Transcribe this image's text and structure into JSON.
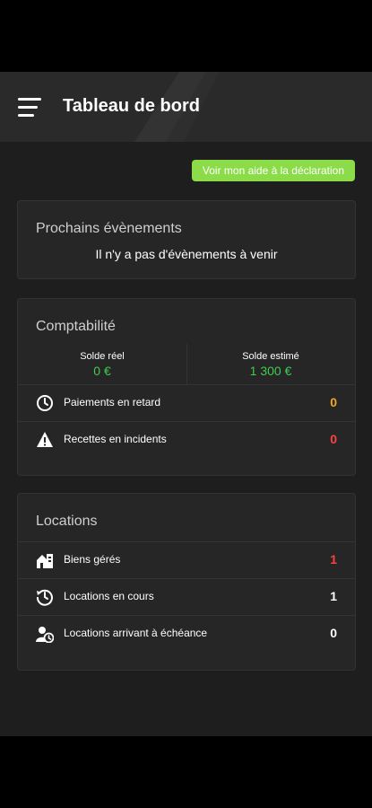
{
  "header": {
    "title": "Tableau de bord",
    "menu_icon": "hamburger-menu-icon"
  },
  "aid_button": {
    "label": "Voir mon aide à la déclaration",
    "color": "#8cdc4a"
  },
  "events": {
    "title": "Prochains évènements",
    "empty_text": "Il n'y a pas d'évènements à venir"
  },
  "compta": {
    "title": "Comptabilité",
    "solde_reel": {
      "label": "Solde réel",
      "value": "0 €"
    },
    "solde_estime": {
      "label": "Solde estimé",
      "value": "1 300 €"
    },
    "rows": [
      {
        "icon": "clock-icon",
        "label": "Paiements en retard",
        "value": "0",
        "color": "#f5a623"
      },
      {
        "icon": "warning-icon",
        "label": "Recettes en incidents",
        "value": "0",
        "color": "#ff4040"
      }
    ]
  },
  "locations": {
    "title": "Locations",
    "rows": [
      {
        "icon": "buildings-icon",
        "label": "Biens gérés",
        "value": "1",
        "color": "#ff4040"
      },
      {
        "icon": "history-clock-icon",
        "label": "Locations en cours",
        "value": "1",
        "color": "#ffffff"
      },
      {
        "icon": "user-clock-icon",
        "label": "Locations arrivant à échéance",
        "value": "0",
        "color": "#ffffff"
      }
    ]
  }
}
